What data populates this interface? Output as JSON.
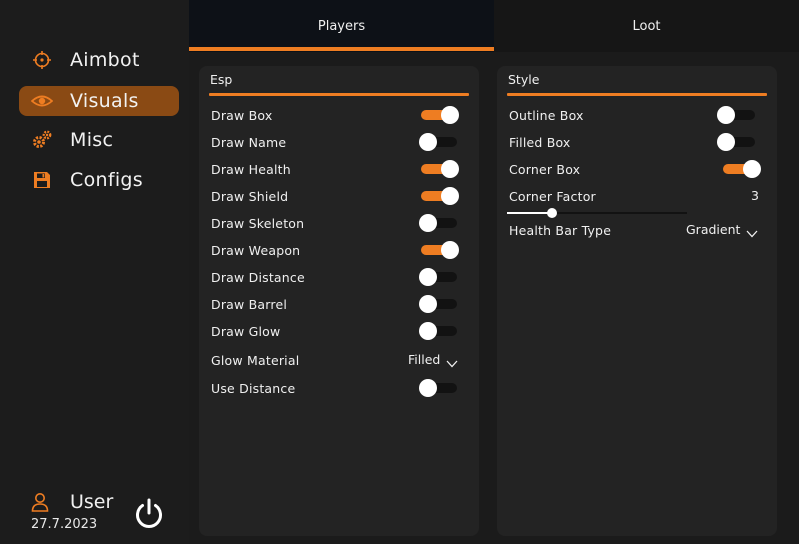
{
  "sidebar": {
    "items": [
      {
        "label": "Aimbot",
        "icon": "crosshair-icon",
        "active": false
      },
      {
        "label": "Visuals",
        "icon": "eye-icon",
        "active": true
      },
      {
        "label": "Misc",
        "icon": "gears-icon",
        "active": false
      },
      {
        "label": "Configs",
        "icon": "save-icon",
        "active": false
      }
    ],
    "user": {
      "name": "User",
      "date": "27.7.2023"
    }
  },
  "tabs": [
    {
      "label": "Players",
      "active": true
    },
    {
      "label": "Loot",
      "active": false
    }
  ],
  "colors": {
    "accent": "#ee7d22",
    "active_nav": "#8a4a14"
  },
  "esp": {
    "title": "Esp",
    "toggles": [
      {
        "label": "Draw Box",
        "on": true
      },
      {
        "label": "Draw Name",
        "on": false
      },
      {
        "label": "Draw Health",
        "on": true
      },
      {
        "label": "Draw Shield",
        "on": true
      },
      {
        "label": "Draw Skeleton",
        "on": false
      },
      {
        "label": "Draw Weapon",
        "on": true
      },
      {
        "label": "Draw Distance",
        "on": false
      },
      {
        "label": "Draw Barrel",
        "on": false
      },
      {
        "label": "Draw Glow",
        "on": false
      }
    ],
    "glow_material": {
      "label": "Glow Material",
      "value": "Filled"
    },
    "use_distance": {
      "label": "Use Distance",
      "on": false
    }
  },
  "style": {
    "title": "Style",
    "toggles": [
      {
        "label": "Outline Box",
        "on": false
      },
      {
        "label": "Filled Box",
        "on": false
      },
      {
        "label": "Corner Box",
        "on": true
      }
    ],
    "corner_factor": {
      "label": "Corner Factor",
      "value": "3",
      "fraction": 0.25
    },
    "health_bar_type": {
      "label": "Health Bar Type",
      "value": "Gradient"
    }
  }
}
